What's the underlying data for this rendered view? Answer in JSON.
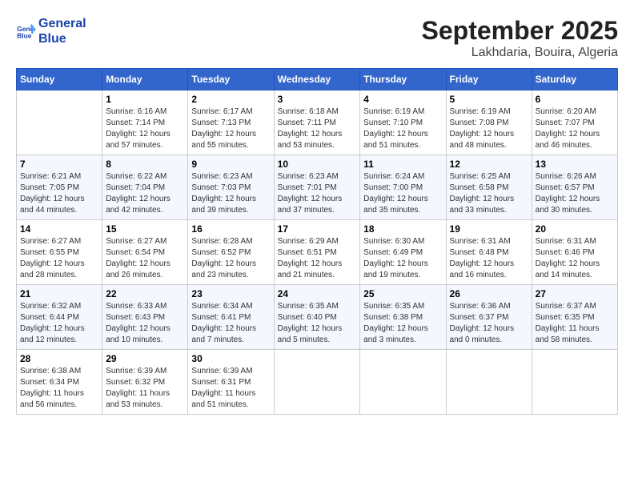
{
  "header": {
    "logo_line1": "General",
    "logo_line2": "Blue",
    "title": "September 2025",
    "subtitle": "Lakhdaria, Bouira, Algeria"
  },
  "calendar": {
    "days_of_week": [
      "Sunday",
      "Monday",
      "Tuesday",
      "Wednesday",
      "Thursday",
      "Friday",
      "Saturday"
    ],
    "weeks": [
      [
        {
          "day": "",
          "info": ""
        },
        {
          "day": "1",
          "info": "Sunrise: 6:16 AM\nSunset: 7:14 PM\nDaylight: 12 hours\nand 57 minutes."
        },
        {
          "day": "2",
          "info": "Sunrise: 6:17 AM\nSunset: 7:13 PM\nDaylight: 12 hours\nand 55 minutes."
        },
        {
          "day": "3",
          "info": "Sunrise: 6:18 AM\nSunset: 7:11 PM\nDaylight: 12 hours\nand 53 minutes."
        },
        {
          "day": "4",
          "info": "Sunrise: 6:19 AM\nSunset: 7:10 PM\nDaylight: 12 hours\nand 51 minutes."
        },
        {
          "day": "5",
          "info": "Sunrise: 6:19 AM\nSunset: 7:08 PM\nDaylight: 12 hours\nand 48 minutes."
        },
        {
          "day": "6",
          "info": "Sunrise: 6:20 AM\nSunset: 7:07 PM\nDaylight: 12 hours\nand 46 minutes."
        }
      ],
      [
        {
          "day": "7",
          "info": "Sunrise: 6:21 AM\nSunset: 7:05 PM\nDaylight: 12 hours\nand 44 minutes."
        },
        {
          "day": "8",
          "info": "Sunrise: 6:22 AM\nSunset: 7:04 PM\nDaylight: 12 hours\nand 42 minutes."
        },
        {
          "day": "9",
          "info": "Sunrise: 6:23 AM\nSunset: 7:03 PM\nDaylight: 12 hours\nand 39 minutes."
        },
        {
          "day": "10",
          "info": "Sunrise: 6:23 AM\nSunset: 7:01 PM\nDaylight: 12 hours\nand 37 minutes."
        },
        {
          "day": "11",
          "info": "Sunrise: 6:24 AM\nSunset: 7:00 PM\nDaylight: 12 hours\nand 35 minutes."
        },
        {
          "day": "12",
          "info": "Sunrise: 6:25 AM\nSunset: 6:58 PM\nDaylight: 12 hours\nand 33 minutes."
        },
        {
          "day": "13",
          "info": "Sunrise: 6:26 AM\nSunset: 6:57 PM\nDaylight: 12 hours\nand 30 minutes."
        }
      ],
      [
        {
          "day": "14",
          "info": "Sunrise: 6:27 AM\nSunset: 6:55 PM\nDaylight: 12 hours\nand 28 minutes."
        },
        {
          "day": "15",
          "info": "Sunrise: 6:27 AM\nSunset: 6:54 PM\nDaylight: 12 hours\nand 26 minutes."
        },
        {
          "day": "16",
          "info": "Sunrise: 6:28 AM\nSunset: 6:52 PM\nDaylight: 12 hours\nand 23 minutes."
        },
        {
          "day": "17",
          "info": "Sunrise: 6:29 AM\nSunset: 6:51 PM\nDaylight: 12 hours\nand 21 minutes."
        },
        {
          "day": "18",
          "info": "Sunrise: 6:30 AM\nSunset: 6:49 PM\nDaylight: 12 hours\nand 19 minutes."
        },
        {
          "day": "19",
          "info": "Sunrise: 6:31 AM\nSunset: 6:48 PM\nDaylight: 12 hours\nand 16 minutes."
        },
        {
          "day": "20",
          "info": "Sunrise: 6:31 AM\nSunset: 6:46 PM\nDaylight: 12 hours\nand 14 minutes."
        }
      ],
      [
        {
          "day": "21",
          "info": "Sunrise: 6:32 AM\nSunset: 6:44 PM\nDaylight: 12 hours\nand 12 minutes."
        },
        {
          "day": "22",
          "info": "Sunrise: 6:33 AM\nSunset: 6:43 PM\nDaylight: 12 hours\nand 10 minutes."
        },
        {
          "day": "23",
          "info": "Sunrise: 6:34 AM\nSunset: 6:41 PM\nDaylight: 12 hours\nand 7 minutes."
        },
        {
          "day": "24",
          "info": "Sunrise: 6:35 AM\nSunset: 6:40 PM\nDaylight: 12 hours\nand 5 minutes."
        },
        {
          "day": "25",
          "info": "Sunrise: 6:35 AM\nSunset: 6:38 PM\nDaylight: 12 hours\nand 3 minutes."
        },
        {
          "day": "26",
          "info": "Sunrise: 6:36 AM\nSunset: 6:37 PM\nDaylight: 12 hours\nand 0 minutes."
        },
        {
          "day": "27",
          "info": "Sunrise: 6:37 AM\nSunset: 6:35 PM\nDaylight: 11 hours\nand 58 minutes."
        }
      ],
      [
        {
          "day": "28",
          "info": "Sunrise: 6:38 AM\nSunset: 6:34 PM\nDaylight: 11 hours\nand 56 minutes."
        },
        {
          "day": "29",
          "info": "Sunrise: 6:39 AM\nSunset: 6:32 PM\nDaylight: 11 hours\nand 53 minutes."
        },
        {
          "day": "30",
          "info": "Sunrise: 6:39 AM\nSunset: 6:31 PM\nDaylight: 11 hours\nand 51 minutes."
        },
        {
          "day": "",
          "info": ""
        },
        {
          "day": "",
          "info": ""
        },
        {
          "day": "",
          "info": ""
        },
        {
          "day": "",
          "info": ""
        }
      ]
    ]
  }
}
